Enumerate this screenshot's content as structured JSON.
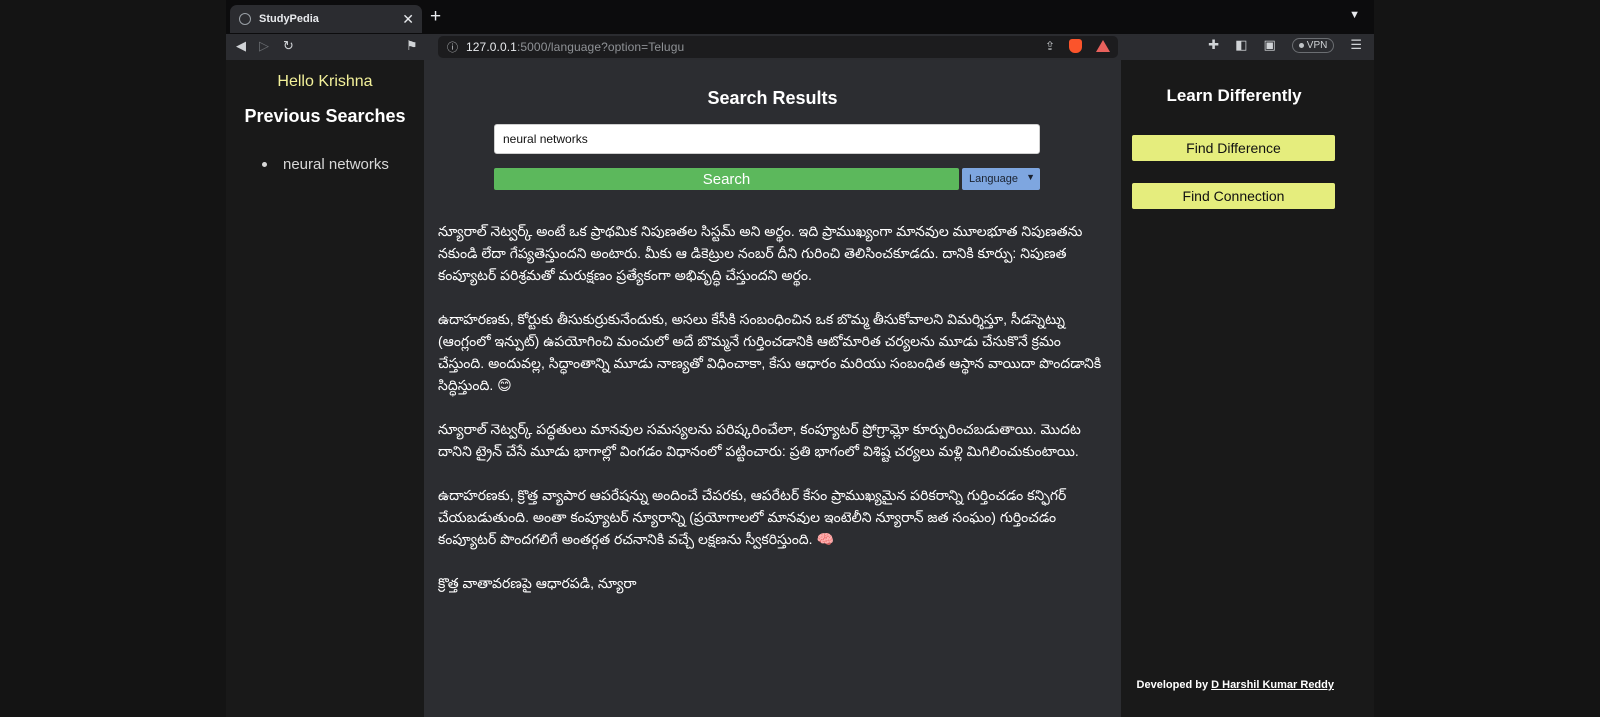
{
  "tab": {
    "title": "StudyPedia"
  },
  "toolbar": {
    "url_host": "127.0.0.1",
    "url_rest": ":5000/language?option=Telugu",
    "vpn_label": "VPN"
  },
  "sidebar_left": {
    "greeting": "Hello Krishna",
    "title": "Previous Searches",
    "items": [
      {
        "label": "neural networks"
      }
    ]
  },
  "main": {
    "title": "Search Results",
    "search_value": "neural networks",
    "search_button": "Search",
    "language_select": "Language",
    "paragraphs": [
      "న్యూరాల్ నెట్వర్క్ అంటే ఒక ప్రాథమిక నిపుణతల సిస్టమ్ అని అర్థం. ఇది ప్రాముఖ్యంగా మానవుల మూలభూత నిపుణతను నకుండి లేదా గేప్యతెస్తుందని అంటారు. మీకు ఆ డికెట్రుల నంబర్ దీని గురించి తెలిసించకూడదు. దానికి కూర్పు: నిపుణత కంప్యూటర్ పరిశ్రమతో మరుక్షణం ప్రత్యేకంగా అభివృద్ధి చేస్తుందని అర్థం.",
      "ఉదాహరణకు, కోర్టుకు తీసుకుర్రుకునేందుకు, అసలు కేసీకి సంబంధించిన ఒక బొమ్మ తీసుకోవాలని విమర్శిస్తూ, సీడస్నెట్ను (ఆంగ్లంలో ఇన్పుట్) ఉపయోగించి మంచులో అదే బొమ్మనే గుర్తించడానికి ఆటోమారిత చర్యలను మూడు చేసుకొనే క్రమం చేస్తుంది. అందువల్ల, సిద్ధాంతాన్ని మూడు నాణ్యతో విధించాకా, కేసు ఆధారం మరియు సంబంధిత ఆస్థాన వాయిదా పొందడానికి సిద్ధిస్తుంది. 😊",
      "న్యూరాల్ నెట్వర్క్ పద్ధతులు మానవుల సమస్యలను పరిష్కరించేలా, కంప్యూటర్ ప్రోగ్రామ్లో కూర్పురించబడుతాయి. మొదట దానిని ట్రైన్ చేసే మూడు భాగాల్లో వింగడం విధానంలో పట్టించారు: ప్రతి భాగంలో విశిష్ట చర్యలు మళ్లి మిగిలించుకుంటాయి.",
      "ఉదాహరణకు, క్రొత్త వ్యాపార ఆపరేషన్ను అందించే చేపరకు, ఆపరేటర్ కేసం ప్రాముఖ్యమైన పరికరాన్ని గుర్తించడం కన్ఫిగర్ చేయబడుతుంది. అంతా కంప్యూటర్ న్యూరాన్ని (ప్రయోగాలలో మానవుల ఇంటెలీని న్యూరాన్ జత సంఘం) గుర్తించడం కంప్యూటర్ పొందగలిగే అంతర్గత రచనానికి వచ్చే లక్షణను స్వీకరిస్తుంది. 🧠",
      "క్రొత్త వాతావరణపై ఆధారపడి, న్యూరా"
    ]
  },
  "sidebar_right": {
    "title": "Learn Differently",
    "find_difference": "Find Difference",
    "find_connection": "Find Connection",
    "footer_prefix": "Developed by ",
    "footer_author": "D Harshil Kumar Reddy"
  },
  "colors": {
    "greeting": "#f3f19a",
    "search_button": "#5cb85c",
    "language_select": "#7ea6e0",
    "side_buttons": "#e5ed7d"
  }
}
